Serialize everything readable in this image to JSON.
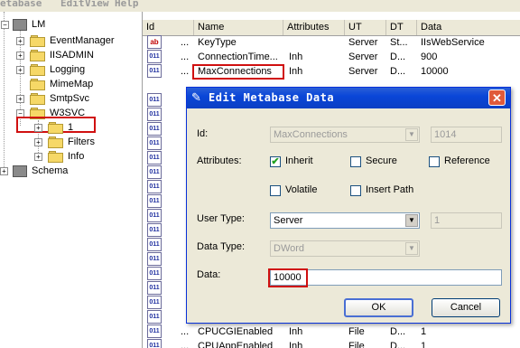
{
  "menu": [
    "etabase",
    "Edit",
    "View",
    "Help"
  ],
  "tree": {
    "root": "LM",
    "items": [
      "EventManager",
      "IISADMIN",
      "Logging",
      "MimeMap",
      "SmtpSvc",
      "W3SVC",
      "1",
      "Filters",
      "Info",
      "Schema"
    ]
  },
  "list": {
    "columns": [
      "Id",
      "Name",
      "Attributes",
      "UT",
      "DT",
      "Data"
    ],
    "rows": [
      {
        "icon": "ab",
        "id": "...",
        "name": "KeyType",
        "attributes": "",
        "ut": "Server",
        "dt": "St...",
        "data": "IIsWebService"
      },
      {
        "icon": "num",
        "id": "...",
        "name": "ConnectionTime...",
        "attributes": "Inh",
        "ut": "Server",
        "dt": "D...",
        "data": "900"
      },
      {
        "icon": "num",
        "id": "...",
        "name": "MaxConnections",
        "attributes": "Inh",
        "ut": "Server",
        "dt": "D...",
        "data": "10000"
      }
    ],
    "bottom_rows": [
      {
        "icon": "num",
        "id": "...",
        "name": "CPUCGIEnabled",
        "attributes": "Inh",
        "ut": "File",
        "dt": "D...",
        "data": "1"
      },
      {
        "icon": "num",
        "id": "...",
        "name": "CPUAppEnabled",
        "attributes": "Inh",
        "ut": "File",
        "dt": "D...",
        "data": "1"
      }
    ]
  },
  "dialog": {
    "title": "Edit Metabase Data",
    "close": "✕",
    "id_label": "Id:",
    "id_name": "MaxConnections",
    "id_number": "1014",
    "attributes_label": "Attributes:",
    "inherit": "Inherit",
    "secure": "Secure",
    "reference": "Reference",
    "volatile": "Volatile",
    "insert_path": "Insert Path",
    "user_type_label": "User Type:",
    "user_type_value": "Server",
    "user_type_number": "1",
    "data_type_label": "Data Type:",
    "data_type_value": "DWord",
    "data_label": "Data:",
    "data_value": "10000",
    "ok": "OK",
    "cancel": "Cancel",
    "checked": "✔"
  },
  "colors": {
    "highlight": "#d01010",
    "title_bar": "#0a46d8",
    "check": "#21a121"
  }
}
